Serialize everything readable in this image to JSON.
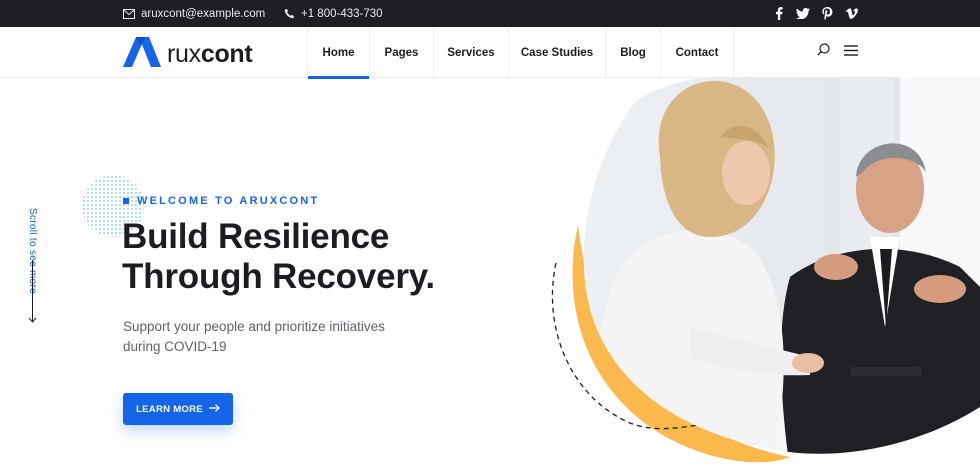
{
  "topbar": {
    "email": "aruxcont@example.com",
    "phone": "+1 800-433-730",
    "social": [
      {
        "icon": "facebook-icon",
        "glyph": "f"
      },
      {
        "icon": "twitter-icon",
        "glyph": "t"
      },
      {
        "icon": "pinterest-icon",
        "glyph": "p"
      },
      {
        "icon": "vimeo-icon",
        "glyph": "v"
      }
    ]
  },
  "brand": {
    "name_light": "rux",
    "name_bold": "cont",
    "accent_color": "#1565e8"
  },
  "nav": {
    "items": [
      {
        "label": "Home",
        "active": true
      },
      {
        "label": "Pages",
        "active": false
      },
      {
        "label": "Services",
        "active": false
      },
      {
        "label": "Case Studies",
        "active": false
      },
      {
        "label": "Blog",
        "active": false
      },
      {
        "label": "Contact",
        "active": false
      }
    ]
  },
  "hero": {
    "scroll_text": "Scroll to see more",
    "eyebrow": "WELCOME TO ARUXCONT",
    "title_line1": "Build Resilience",
    "title_line2": "Through Recovery.",
    "subtitle_line1": "Support your people and prioritize initiatives",
    "subtitle_line2": "during COVID-19",
    "cta_label": "LEARN MORE"
  },
  "colors": {
    "primary": "#1565e8",
    "dark": "#1b1d22",
    "topbar": "#1d1f24",
    "accent_yellow": "#fbb84c",
    "accent_blue": "#2f9ff0"
  }
}
